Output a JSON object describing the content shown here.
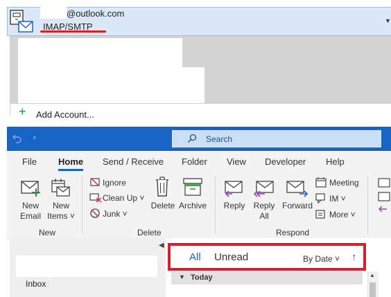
{
  "account": {
    "email": "@outlook.com",
    "type": "IMAP/SMTP",
    "add_account": "Add Account..."
  },
  "titlebar": {
    "search_label": "Search"
  },
  "tabs": [
    "File",
    "Home",
    "Send / Receive",
    "Folder",
    "View",
    "Developer",
    "Help"
  ],
  "ribbon": {
    "new_email": [
      "New",
      "Email"
    ],
    "new_items": [
      "New",
      "Items ˅"
    ],
    "ignore": "Ignore",
    "clean_up": "Clean Up ˅",
    "junk": "Junk ˅",
    "delete": "Delete",
    "archive": "Archive",
    "reply": "Reply",
    "reply_all": [
      "Reply",
      "All"
    ],
    "forward": "Forward",
    "meeting": "Meeting",
    "im": "IM ˅",
    "more": "More ˅",
    "groups": [
      "New",
      "Delete",
      "Respond"
    ]
  },
  "folders": {
    "inbox": "Inbox"
  },
  "message_list": {
    "filter_all": "All",
    "filter_unread": "Unread",
    "sort_label": "By Date ˅",
    "sort_direction": "↑",
    "group_label": "Today"
  },
  "colors": {
    "brand_blue": "#1764c5",
    "annotation_red": "#d81f2a"
  }
}
